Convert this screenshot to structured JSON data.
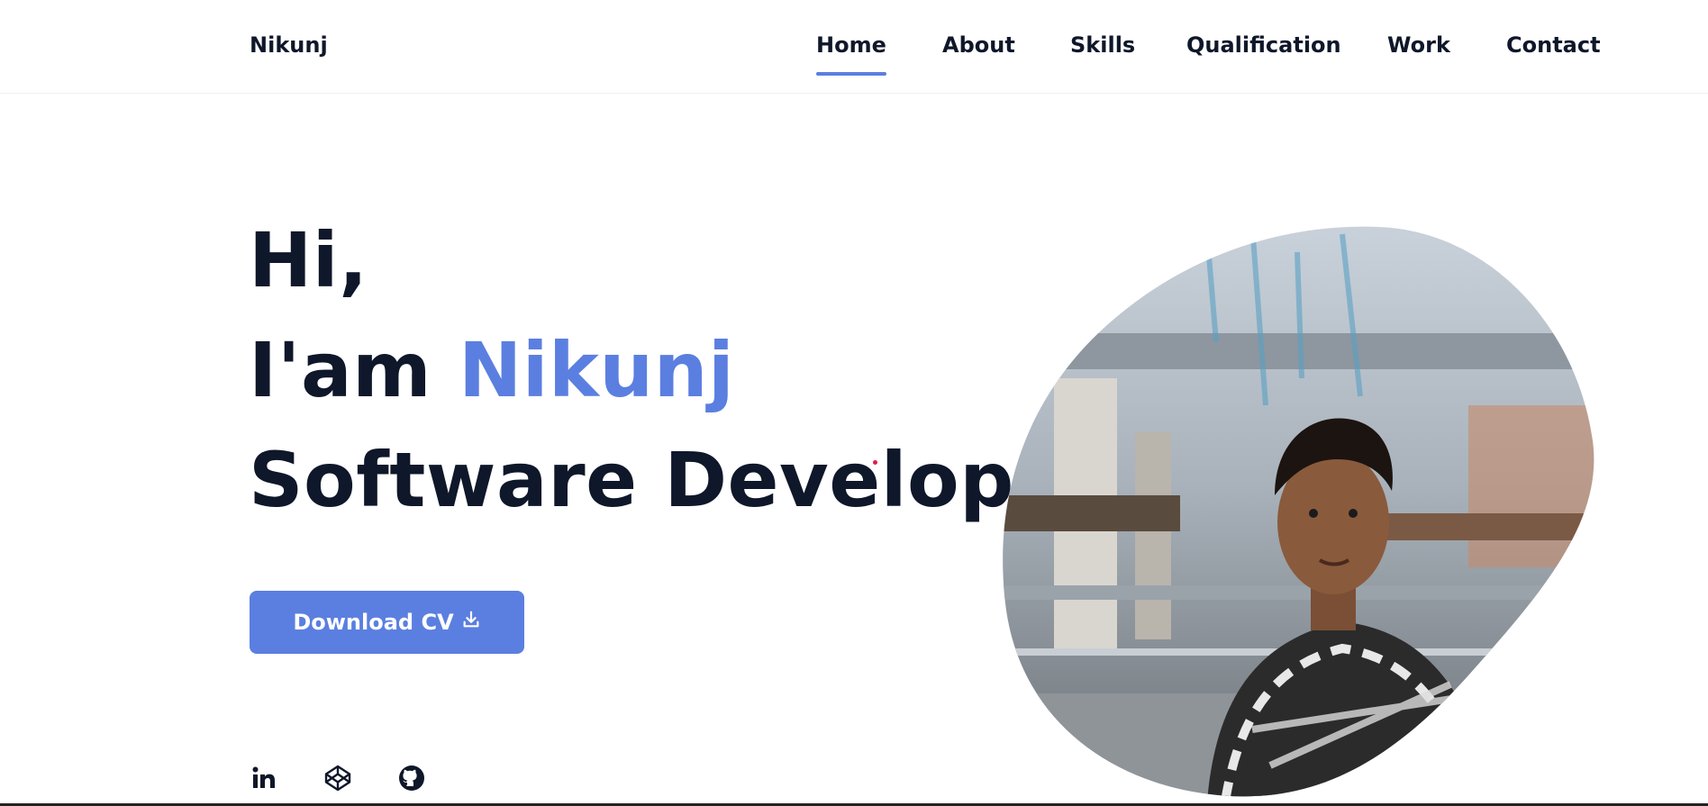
{
  "header": {
    "logo": "Nikunj",
    "nav": [
      {
        "label": "Home",
        "active": true
      },
      {
        "label": "About",
        "active": false
      },
      {
        "label": "Skills",
        "active": false
      },
      {
        "label": "Qualification",
        "active": false
      },
      {
        "label": "Work",
        "active": false
      },
      {
        "label": "Contact",
        "active": false
      }
    ]
  },
  "hero": {
    "greeting": "Hi,",
    "intro_prefix": "I'am",
    "name": "Nikunj",
    "role": "Software Developer",
    "cta_label": "Download CV",
    "cta_icon": "download-icon"
  },
  "social": [
    {
      "icon": "linkedin-icon"
    },
    {
      "icon": "codepen-icon"
    },
    {
      "icon": "github-icon"
    }
  ],
  "colors": {
    "accent": "#5b7fe0",
    "text": "#0f172a",
    "background": "#ffffff"
  }
}
